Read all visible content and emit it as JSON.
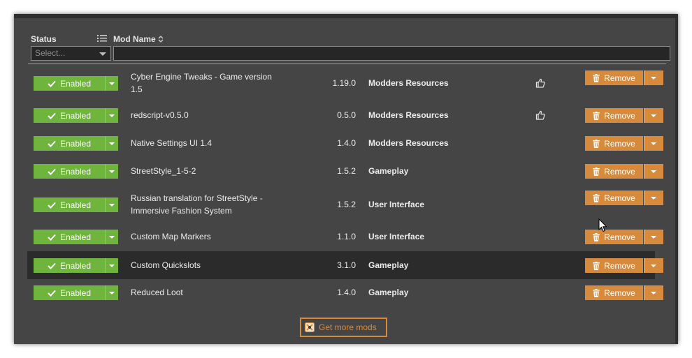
{
  "header": {
    "status_label": "Status",
    "mod_name_label": "Mod Name",
    "status_select_placeholder": "Select..."
  },
  "colors": {
    "enabled_green": "#6fb43c",
    "remove_orange": "#d88a3c",
    "panel_bg": "#454545",
    "selected_row_bg": "#2b2b2b"
  },
  "mods": [
    {
      "status": "Enabled",
      "name": "Cyber Engine Tweaks - Game version 1.5",
      "version": "1.19.0",
      "category": "Modders Resources",
      "endorsed": true,
      "remove_label": "Remove"
    },
    {
      "status": "Enabled",
      "name": "redscript-v0.5.0",
      "version": "0.5.0",
      "category": "Modders Resources",
      "endorsed": true,
      "remove_label": "Remove"
    },
    {
      "status": "Enabled",
      "name": "Native Settings UI 1.4",
      "version": "1.4.0",
      "category": "Modders Resources",
      "endorsed": false,
      "remove_label": "Remove"
    },
    {
      "status": "Enabled",
      "name": "StreetStyle_1-5-2",
      "version": "1.5.2",
      "category": "Gameplay",
      "endorsed": false,
      "remove_label": "Remove"
    },
    {
      "status": "Enabled",
      "name": "Russian translation for StreetStyle - Immersive Fashion System",
      "version": "1.5.2",
      "category": "User Interface",
      "endorsed": false,
      "remove_label": "Remove"
    },
    {
      "status": "Enabled",
      "name": "Custom Map Markers",
      "version": "1.1.0",
      "category": "User Interface",
      "endorsed": false,
      "remove_label": "Remove"
    },
    {
      "status": "Enabled",
      "name": "Custom Quickslots",
      "version": "3.1.0",
      "category": "Gameplay",
      "endorsed": false,
      "remove_label": "Remove",
      "selected": true
    },
    {
      "status": "Enabled",
      "name": "Reduced Loot",
      "version": "1.4.0",
      "category": "Gameplay",
      "endorsed": false,
      "remove_label": "Remove"
    }
  ],
  "footer": {
    "get_more_label": "Get more mods"
  }
}
